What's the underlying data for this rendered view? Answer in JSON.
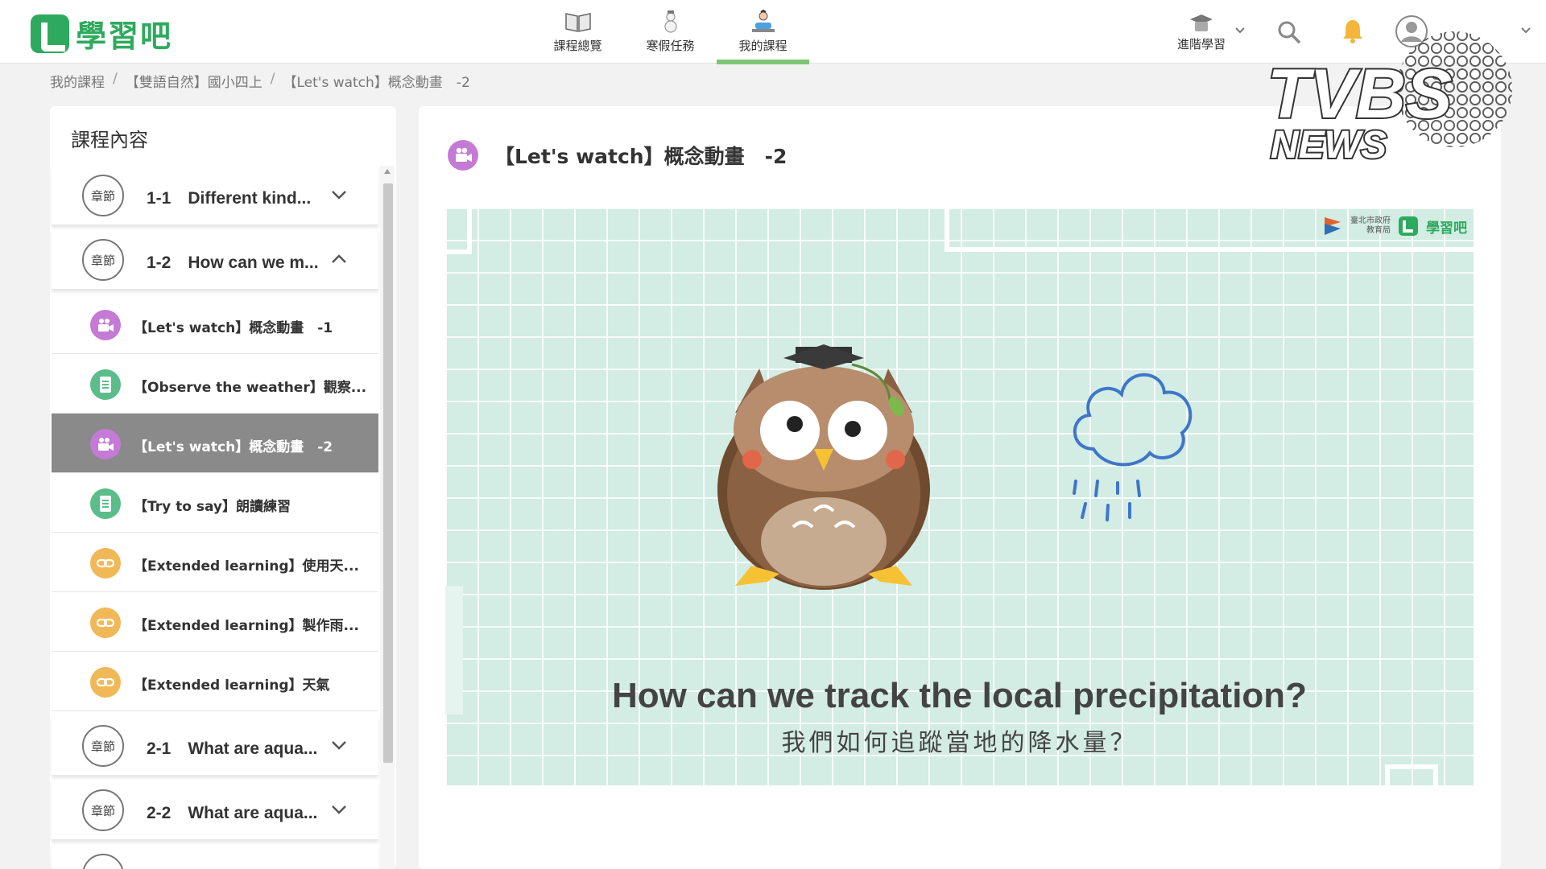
{
  "app": {
    "logo_text": "學習吧"
  },
  "topnav": {
    "items": [
      {
        "label": "課程總覽",
        "icon": "book-icon",
        "active": false
      },
      {
        "label": "寒假任務",
        "icon": "snowman-icon",
        "active": false
      },
      {
        "label": "我的課程",
        "icon": "student-icon",
        "active": true
      }
    ],
    "advanced_label": "進階學習",
    "icons": [
      "graduation-cap-icon",
      "search-icon",
      "bell-icon",
      "avatar-icon"
    ]
  },
  "breadcrumb": {
    "items": [
      "我的課程",
      "【雙語自然】國小四上",
      "【Let's watch】概念動畫　-2"
    ],
    "separator": "/"
  },
  "sidebar": {
    "title": "課程內容",
    "chapter_badge": "章節",
    "chapters_top": [
      {
        "label": "1-1　Different kind...",
        "expanded": false
      },
      {
        "label": "1-2　How can we m...",
        "expanded": true
      }
    ],
    "lessons": [
      {
        "label": "【Let's watch】概念動畫　-1",
        "type": "video",
        "color": "#c57ad6",
        "active": false
      },
      {
        "label": "【Observe the weather】觀察...",
        "type": "document",
        "color": "#5bbd8a",
        "active": false
      },
      {
        "label": "【Let's watch】概念動畫　-2",
        "type": "video",
        "color": "#c57ad6",
        "active": true
      },
      {
        "label": "【Try to say】朗讀練習",
        "type": "document",
        "color": "#5bbd8a",
        "active": false
      },
      {
        "label": "【Extended learning】使用天...",
        "type": "link",
        "color": "#f0b857",
        "active": false
      },
      {
        "label": "【Extended learning】製作雨...",
        "type": "link",
        "color": "#f0b857",
        "active": false
      },
      {
        "label": "【Extended learning】天氣",
        "type": "link",
        "color": "#f0b857",
        "active": false
      }
    ],
    "chapters_bottom": [
      {
        "label": "2-1　What are aqua...",
        "expanded": false
      },
      {
        "label": "2-2　What are aqua...",
        "expanded": false
      }
    ]
  },
  "main": {
    "title": "【Let's watch】概念動畫　-2",
    "title_icon": "video-camera-icon",
    "video": {
      "caption_en": "How can we track the local precipitation?",
      "caption_zh": "我們如何追蹤當地的降水量？",
      "brand_gov_line1": "臺北市政府",
      "brand_gov_line2": "教育局",
      "brand_logo": "學習吧"
    }
  },
  "watermark": {
    "text_top": "TVBS",
    "text_bottom": "NEWS"
  },
  "colors": {
    "brand_green": "#2eaa5e",
    "nav_active": "#7cc576",
    "video_bg": "#d3ece4",
    "active_row": "#8a8a8a"
  }
}
